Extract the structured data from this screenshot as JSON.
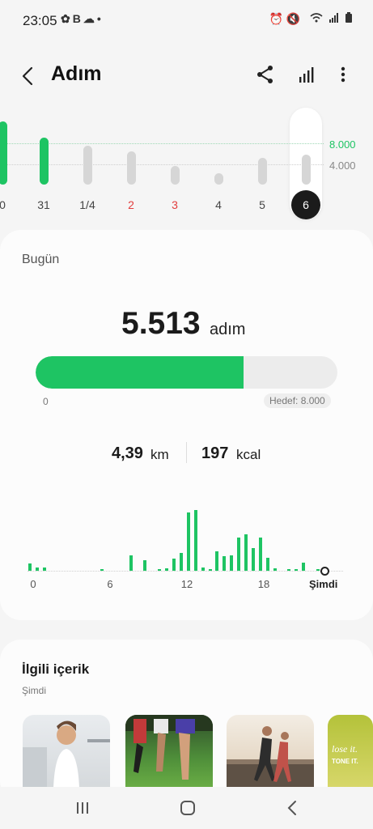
{
  "status": {
    "time": "23:05",
    "left_icons": [
      "notification-icon",
      "b-icon",
      "cloud-icon",
      "dot-icon"
    ],
    "right_icons": [
      "alarm-icon",
      "mute-icon",
      "wifi-icon",
      "signal-icon",
      "battery-icon"
    ]
  },
  "header": {
    "title": "Adım"
  },
  "week": {
    "goal_high": "8.000",
    "goal_low": "4.000",
    "days": [
      {
        "label": "0",
        "color": "normal",
        "fill": "green",
        "level": 1.0
      },
      {
        "label": "31",
        "color": "normal",
        "fill": "green",
        "level": 0.75
      },
      {
        "label": "1/4",
        "color": "normal",
        "fill": "gray",
        "level": 0.62
      },
      {
        "label": "2",
        "color": "red",
        "fill": "gray",
        "level": 0.52
      },
      {
        "label": "3",
        "color": "red",
        "fill": "gray",
        "level": 0.3
      },
      {
        "label": "4",
        "color": "normal",
        "fill": "gray",
        "level": 0.18
      },
      {
        "label": "5",
        "color": "normal",
        "fill": "gray",
        "level": 0.42
      },
      {
        "label": "6",
        "color": "selected",
        "fill": "gray",
        "level": 0.48
      }
    ]
  },
  "today": {
    "label": "Bugün",
    "steps": "5.513",
    "steps_unit": "adım",
    "progress": 0.689,
    "progress_min": "0",
    "goal_label": "Hedef: 8.000",
    "distance": "4,39",
    "distance_unit": "km",
    "kcal": "197",
    "kcal_unit": "kcal"
  },
  "hourly": {
    "levels": [
      0.12,
      0.05,
      0.06,
      0,
      0,
      0,
      0,
      0,
      0,
      0,
      0.02,
      0,
      0,
      0,
      0.26,
      0,
      0.18,
      0,
      0.03,
      0.04,
      0.2,
      0.3,
      0.96,
      1.0,
      0.06,
      0.02,
      0.32,
      0.24,
      0.25,
      0.55,
      0.6,
      0.38,
      0.55,
      0.22,
      0.04,
      0,
      0.02,
      0.03,
      0.14,
      0,
      0.02,
      0.02
    ],
    "labels": [
      "0",
      "6",
      "12",
      "18"
    ],
    "now_label": "Şimdi"
  },
  "related": {
    "title": "İlgili içerik",
    "subtitle": "Şimdi",
    "thumb_text_1": "lose it.",
    "thumb_text_2": "TONE IT."
  },
  "colors": {
    "accent": "#1ec463",
    "weekend": "#e23d3d"
  }
}
